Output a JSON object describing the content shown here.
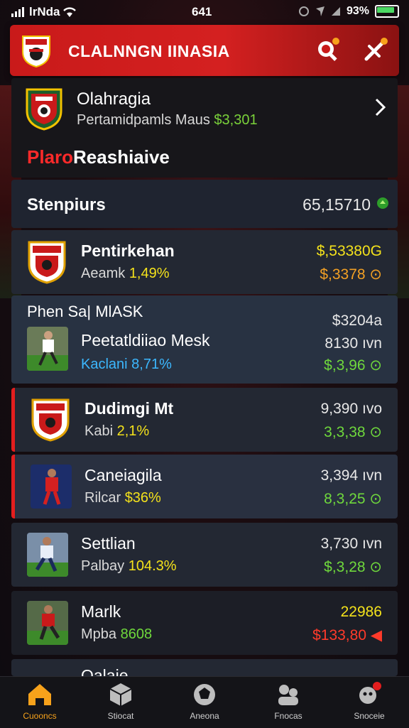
{
  "status": {
    "carrier": "lrNda",
    "time": "641",
    "battery": "93%"
  },
  "header": {
    "title": "CLALNNGN IINASIA"
  },
  "featured": {
    "title": "Olahragia",
    "subtitle": "Pertamidpamls Maus",
    "subtitle_value": "$3,301",
    "promo_red": "Plaro",
    "promo_white": "Reashiaive"
  },
  "standings": {
    "title": "Stenpiurs",
    "value": "65,15710"
  },
  "rows": [
    {
      "name": "Pentirkehan",
      "sub_label": "Aeamk",
      "sub_value": "1,49%",
      "val1": "$,53380G",
      "val2": "$,3378 ⊙"
    },
    {
      "header": "Phen Sa| MlASK",
      "name": "Peetatldiiao Mesk",
      "sub_label": "Kaclani",
      "sub_value": "8,71%",
      "val0": "$3204a",
      "val1": "8130 ıvn",
      "val2": "$,3,96 ⊙"
    },
    {
      "name": "Dudimgi Mt",
      "sub_label": "Kabi",
      "sub_value": "2,1%",
      "val1": "9,390 ıvo",
      "val2": "3,3,38 ⊙"
    },
    {
      "name": "Caneiagila",
      "sub_label": "Rilcar",
      "sub_value": "$36%",
      "val1": "3,394 ıvn",
      "val2": "8,3,25 ⊙"
    },
    {
      "name": "Settlian",
      "sub_label": "Palbay",
      "sub_value": "104.3%",
      "val1": "3,730 ıvn",
      "val2": "$,3,28 ⊙"
    },
    {
      "name": "Marlk",
      "sub_label": "Mpba",
      "sub_value": "8608",
      "val1": "22986",
      "val2": "$133,80 ◀"
    },
    {
      "name": "Oalaie"
    }
  ],
  "nav": [
    {
      "label": "Cuooncs",
      "icon": "home-icon"
    },
    {
      "label": "Stiocat",
      "icon": "cube-icon"
    },
    {
      "label": "Aneona",
      "icon": "ball-icon"
    },
    {
      "label": "Fnocas",
      "icon": "stats-icon"
    },
    {
      "label": "Snoceie",
      "icon": "profile-icon"
    }
  ],
  "colors": {
    "accent": "#d42020",
    "gold": "#f7a21b",
    "green": "#6fd83c",
    "yellow": "#f4e21b"
  }
}
